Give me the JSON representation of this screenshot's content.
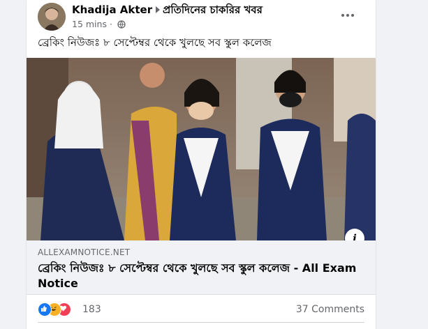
{
  "post": {
    "author": "Khadija Akter",
    "group": "প্রতিদিনের চাকরির খবর",
    "time": "15 mins",
    "privacy_icon": "globe-icon",
    "more_icon": "more-options-icon",
    "text": "ব্রেকিং নিউজঃ ৮ সেপ্টেম্বর থেকে খুলছে সব স্কুল কলেজ"
  },
  "link": {
    "image_icon": "info-icon",
    "info_label": "i",
    "domain": "ALLEXAMNOTICE.NET",
    "title": "ব্রেকিং নিউজঃ ৮ সেপ্টেম্বর থেকে খুলছে সব স্কুল কলেজ - All Exam Notice"
  },
  "reactions": {
    "icons": [
      "like-icon",
      "haha-icon",
      "love-icon"
    ],
    "colors": {
      "like": "#1877f2",
      "haha": "#f7b125",
      "love": "#f33e58"
    },
    "count": "183",
    "comments": "37 Comments"
  }
}
